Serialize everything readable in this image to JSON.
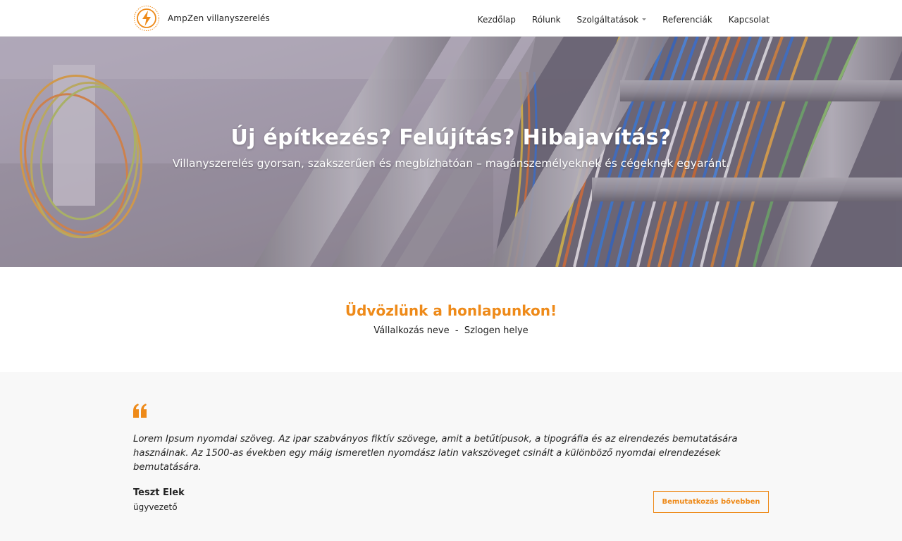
{
  "header": {
    "brand_name": "AmpZen villanyszerelés",
    "nav": [
      {
        "label": "Kezdőlap"
      },
      {
        "label": "Rólunk"
      },
      {
        "label": "Szolgáltatások"
      },
      {
        "label": "Referenciák"
      },
      {
        "label": "Kapcsolat"
      }
    ]
  },
  "hero": {
    "title": "Új építkezés? Felújítás? Hibajavítás?",
    "subtitle": "Villanyszerelés gyorsan, szakszerűen és megbízhatóan – magánszemélyeknek és cégeknek egyaránt."
  },
  "welcome": {
    "heading": "Üdvözlünk a honlapunkon!",
    "tagline": "Vállalkozás neve  -  Szlogen helye"
  },
  "testimonial": {
    "quote": "Lorem Ipsum nyomdai szöveg. Az ipar szabványos fiktív szövege, amit a betűtípusok, a tipográfia és az elrendezés bemutatására használnak. Az 1500-as években egy máig ismeretlen nyomdász latin vakszöveget csinált a különböző nyomdai elrendezések bemutatására.",
    "author_name": "Teszt Elek",
    "author_role": "ügyvezető",
    "button_label": "Bemutatkozás bővebben"
  },
  "icons": {
    "logo": "lightning-bolt-logo",
    "quote": "quote-icon",
    "dropdown": "chevron-down-icon"
  },
  "colors": {
    "accent": "#ee8a19",
    "text": "#222222",
    "testimonial_bg": "#f8f8f8"
  }
}
